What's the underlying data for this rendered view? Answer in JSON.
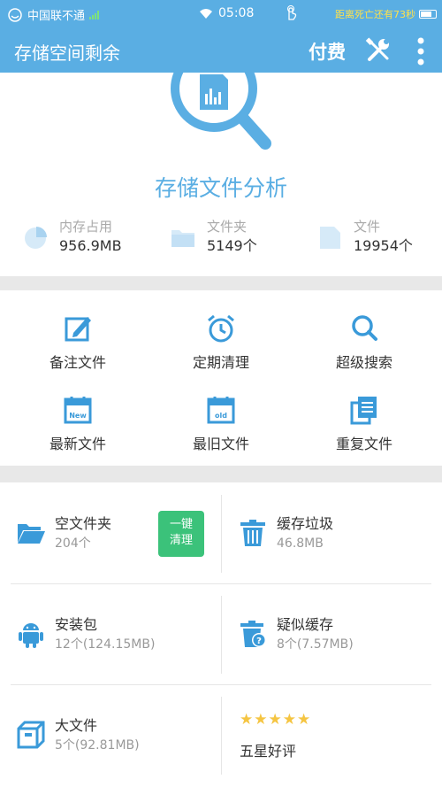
{
  "status_bar": {
    "carrier": "中国联不通",
    "time": "05:08",
    "countdown": "距离死亡还有73秒"
  },
  "app_bar": {
    "title": "存储空间剩余",
    "pay_label": "付费",
    "tools_icon": "wrench-screwdriver-icon",
    "more_icon": "more-vert-icon"
  },
  "hero": {
    "title": "存储文件分析",
    "stats": [
      {
        "label": "内存占用",
        "value": "956.9MB",
        "icon": "pie-chart-icon"
      },
      {
        "label": "文件夹",
        "value": "5149个",
        "icon": "folder-icon"
      },
      {
        "label": "文件",
        "value": "19954个",
        "icon": "file-icon"
      }
    ]
  },
  "tools": [
    {
      "label": "备注文件",
      "icon": "edit-note-icon"
    },
    {
      "label": "定期清理",
      "icon": "alarm-clock-icon"
    },
    {
      "label": "超级搜索",
      "icon": "search-icon"
    },
    {
      "label": "最新文件",
      "icon": "calendar-new-icon"
    },
    {
      "label": "最旧文件",
      "icon": "calendar-old-icon"
    },
    {
      "label": "重复文件",
      "icon": "copy-files-icon"
    }
  ],
  "cards": [
    {
      "name": "空文件夹",
      "sub": "204个",
      "icon": "folder-open-icon"
    },
    {
      "name": "缓存垃圾",
      "sub": "46.8MB",
      "icon": "trash-icon"
    },
    {
      "name": "安装包",
      "sub": "12个(124.15MB)",
      "icon": "android-icon"
    },
    {
      "name": "疑似缓存",
      "sub": "8个(7.57MB)",
      "icon": "trash-question-icon"
    },
    {
      "name": "大文件",
      "sub": "5个(92.81MB)",
      "icon": "box-icon"
    }
  ],
  "clean_button": {
    "line1": "一键",
    "line2": "清理"
  },
  "rating": {
    "stars": "★★★★★",
    "label": "五星好评"
  },
  "colors": {
    "primary": "#5aaee3",
    "accent_green": "#3bc27a",
    "star": "#f5c542",
    "icon_blue": "#3a9ad9"
  }
}
